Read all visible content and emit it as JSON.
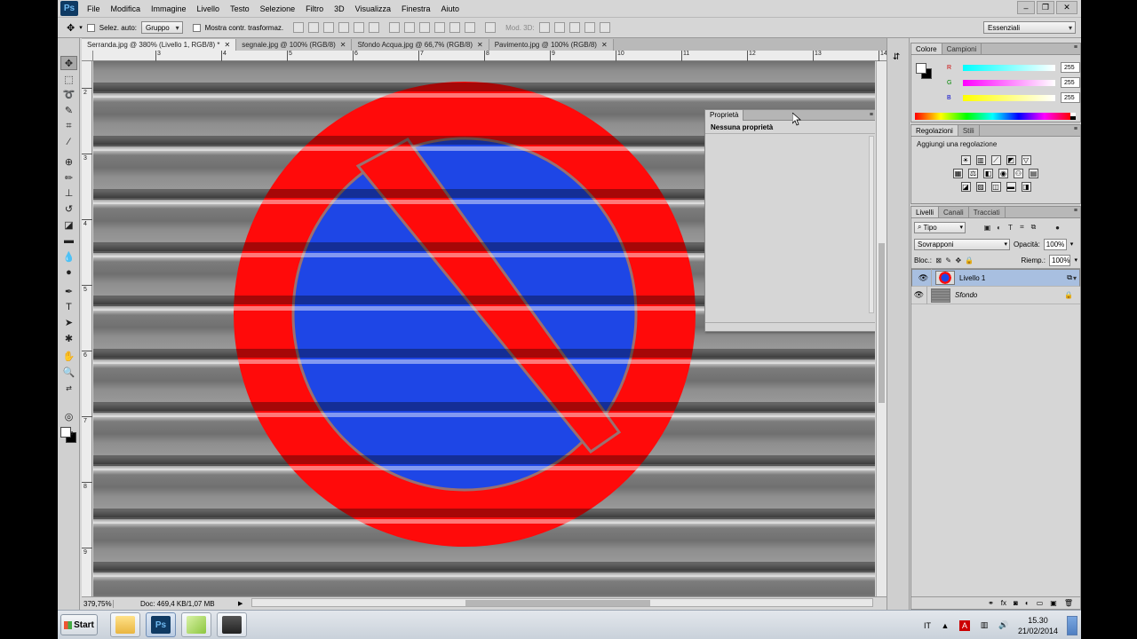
{
  "app": {
    "logo": "Ps",
    "menu": [
      "File",
      "Modifica",
      "Immagine",
      "Livello",
      "Testo",
      "Selezione",
      "Filtro",
      "3D",
      "Visualizza",
      "Finestra",
      "Aiuto"
    ],
    "window_controls": [
      "–",
      "❐",
      "✕"
    ]
  },
  "options_bar": {
    "auto_select_label": "Selez. auto:",
    "auto_select_value": "Gruppo",
    "transform_label": "Mostra contr. trasformaz.",
    "mode_3d_label": "Mod. 3D:",
    "workspace": "Essenziali"
  },
  "tabs": [
    {
      "label": "Serranda.jpg @ 380% (Livello 1, RGB/8) *",
      "active": true
    },
    {
      "label": "segnale.jpg @ 100% (RGB/8)",
      "active": false
    },
    {
      "label": "Sfondo Acqua.jpg @ 66,7% (RGB/8)",
      "active": false
    },
    {
      "label": "Pavimento.jpg @ 100% (RGB/8)",
      "active": false
    }
  ],
  "ruler": {
    "h_labels": [
      "3",
      "4",
      "5",
      "6",
      "7",
      "8",
      "9",
      "10",
      "11",
      "12",
      "13",
      "14"
    ],
    "v_labels": [
      "2",
      "3",
      "4",
      "5",
      "6",
      "7",
      "8",
      "9"
    ]
  },
  "status": {
    "zoom": "379,75%",
    "doc": "Doc: 469,4 KB/1,07 MB"
  },
  "properties_panel": {
    "tab": "Proprietà",
    "content": "Nessuna proprietà"
  },
  "color_panel": {
    "tabs": [
      "Colore",
      "Campioni"
    ],
    "channels": [
      {
        "label": "R",
        "value": "255"
      },
      {
        "label": "G",
        "value": "255"
      },
      {
        "label": "B",
        "value": "255"
      }
    ]
  },
  "adjustments_panel": {
    "tabs": [
      "Regolazioni",
      "Stili"
    ],
    "title": "Aggiungi una regolazione"
  },
  "layers_panel": {
    "tabs": [
      "Livelli",
      "Canali",
      "Tracciati"
    ],
    "filter": "Tipo",
    "blend_mode": "Sovrapponi",
    "opacity_label": "Opacità:",
    "opacity_value": "100%",
    "lock_label": "Bloc.:",
    "fill_label": "Riemp.:",
    "fill_value": "100%",
    "layers": [
      {
        "name": "Livello 1",
        "selected": true
      },
      {
        "name": "Sfondo",
        "selected": false
      }
    ]
  },
  "taskbar": {
    "start_label": "Start",
    "language": "IT",
    "time": "15.30",
    "date": "21/02/2014"
  },
  "colors": {
    "sign_red": "#ff0a0a",
    "sign_blue": "#1e46e6",
    "layer_selected": "#a8bfe0"
  }
}
